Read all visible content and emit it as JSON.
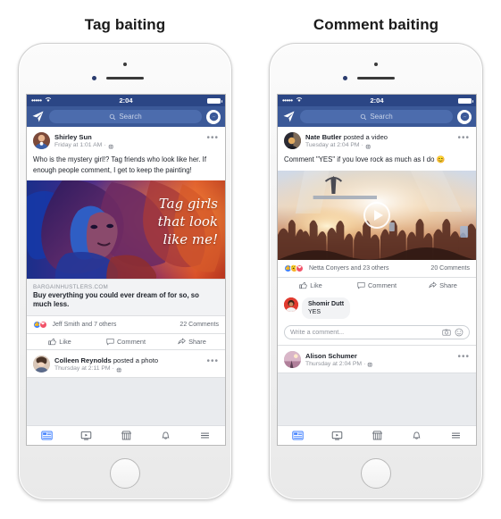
{
  "captions": {
    "left": "Tag baiting",
    "right": "Comment baiting"
  },
  "colors": {
    "facebook_blue": "#3b5998",
    "status_bar_blue": "#2b4685",
    "feed_bg": "#e9ebee",
    "like_blue": "#4080ff",
    "love_red": "#f25268",
    "wow_yellow": "#f7b125",
    "text_dark": "#1d2129",
    "text_muted": "#90949c"
  },
  "phones": [
    {
      "id": "tag-baiting-phone",
      "status_bar": {
        "signal": "•••••",
        "wifi": "wifi-icon",
        "time": "2:04",
        "battery": "battery-icon"
      },
      "header": {
        "send_icon": "messenger-send-icon",
        "search_placeholder": "Search",
        "search_icon": "search-icon",
        "messenger_icon": "messenger-icon"
      },
      "posts": [
        {
          "author": "Shirley Sun",
          "author_suffix": "",
          "timestamp": "Friday at 1:01 AM",
          "privacy_icon": "globe-icon",
          "menu_icon": "more-options-icon",
          "body": "Who is the mystery girl!? Tag friends who look like her. If enough people comment, I get to keep the painting!",
          "media_type": "image",
          "media_overlay_lines": [
            "Tag girls",
            "that look",
            "like me!"
          ],
          "link_card": {
            "domain": "BARGAINHUSTLERS.COM",
            "title": "Buy everything you could ever dream of for so, so much less."
          },
          "reactions": [
            "like",
            "love"
          ],
          "reaction_names": "Jeff Smith and 7 others",
          "comment_count": "22 Comments",
          "actions": [
            {
              "label": "Like",
              "icon": "thumbs-up-icon"
            },
            {
              "label": "Comment",
              "icon": "comment-bubble-icon"
            },
            {
              "label": "Share",
              "icon": "share-arrow-icon"
            }
          ]
        },
        {
          "author": "Colleen Reynolds",
          "author_suffix": " posted a photo",
          "timestamp": "Thursday at 2:11 PM",
          "privacy_icon": "globe-icon",
          "menu_icon": "more-options-icon"
        }
      ],
      "nav": [
        {
          "name": "news-feed",
          "icon": "news-feed-icon",
          "active": true
        },
        {
          "name": "watch",
          "icon": "video-play-icon",
          "active": false
        },
        {
          "name": "marketplace",
          "icon": "store-icon",
          "active": false
        },
        {
          "name": "notifications",
          "icon": "bell-icon",
          "active": false
        },
        {
          "name": "menu",
          "icon": "hamburger-menu-icon",
          "active": false
        }
      ]
    },
    {
      "id": "comment-baiting-phone",
      "status_bar": {
        "signal": "•••••",
        "wifi": "wifi-icon",
        "time": "2:04",
        "battery": "battery-icon"
      },
      "header": {
        "send_icon": "messenger-send-icon",
        "search_placeholder": "Search",
        "search_icon": "search-icon",
        "messenger_icon": "messenger-icon"
      },
      "posts": [
        {
          "author": "Nate Butler",
          "author_suffix": " posted a video",
          "timestamp": "Tuesday at 2:04 PM",
          "privacy_icon": "globe-icon",
          "menu_icon": "more-options-icon",
          "body": "Comment \"YES\" if you love rock as much as I do 😊",
          "media_type": "video",
          "play_button_icon": "play-button-icon",
          "reactions": [
            "like",
            "wow",
            "love"
          ],
          "reaction_names": "Netta Conyers and 23 others",
          "comment_count": "20 Comments",
          "actions": [
            {
              "label": "Like",
              "icon": "thumbs-up-icon"
            },
            {
              "label": "Comment",
              "icon": "comment-bubble-icon"
            },
            {
              "label": "Share",
              "icon": "share-arrow-icon"
            }
          ],
          "comment": {
            "author": "Shomir Dutt",
            "text": "YES"
          },
          "composer": {
            "placeholder": "Write a comment...",
            "camera_icon": "camera-icon",
            "emoji_icon": "emoji-smiley-icon"
          }
        },
        {
          "author": "Alison Schumer",
          "author_suffix": "",
          "timestamp": "Thursday at 2:04 PM",
          "privacy_icon": "globe-icon",
          "menu_icon": "more-options-icon"
        }
      ],
      "nav": [
        {
          "name": "news-feed",
          "icon": "news-feed-icon",
          "active": true
        },
        {
          "name": "watch",
          "icon": "video-play-icon",
          "active": false
        },
        {
          "name": "marketplace",
          "icon": "store-icon",
          "active": false
        },
        {
          "name": "notifications",
          "icon": "bell-icon",
          "active": false
        },
        {
          "name": "menu",
          "icon": "hamburger-menu-icon",
          "active": false
        }
      ]
    }
  ]
}
